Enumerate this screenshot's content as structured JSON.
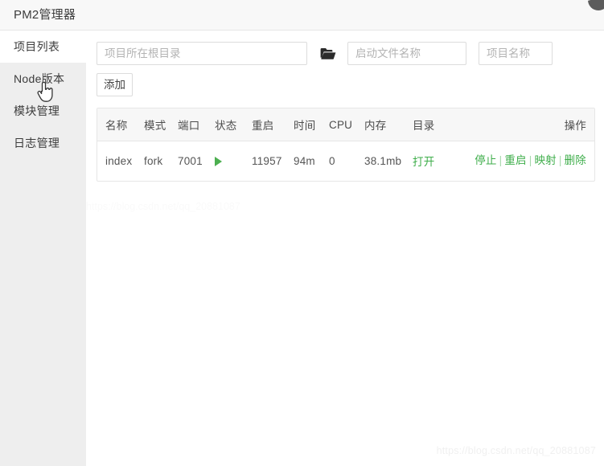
{
  "header": {
    "title": "PM2管理器",
    "corner_badge_name": "window-corner-badge"
  },
  "sidebar": {
    "items": [
      {
        "label": "项目列表",
        "name": "sidebar-item-project-list",
        "active": true
      },
      {
        "label": "Node版本",
        "name": "sidebar-item-node-version",
        "active": false
      },
      {
        "label": "模块管理",
        "name": "sidebar-item-module-manage",
        "active": false
      },
      {
        "label": "日志管理",
        "name": "sidebar-item-log-manage",
        "active": false
      }
    ]
  },
  "toolbar": {
    "root_dir_placeholder": "项目所在根目录",
    "root_dir_value": "",
    "folder_icon": "folder-open-icon",
    "start_file_placeholder": "启动文件名称",
    "start_file_value": "",
    "project_name_placeholder": "项目名称",
    "project_name_value": "",
    "add_label": "添加"
  },
  "table": {
    "columns": [
      "名称",
      "模式",
      "端口",
      "状态",
      "重启",
      "时间",
      "CPU",
      "内存",
      "目录",
      "操作"
    ],
    "rows": [
      {
        "name": "index",
        "mode": "fork",
        "port": "7001",
        "status_icon": "play-running-icon",
        "restart": "11957",
        "time": "94m",
        "cpu": "0",
        "memory": "38.1mb",
        "dir_label": "打开",
        "ops": [
          "停止",
          "重启",
          "映射",
          "删除"
        ],
        "ops_separator": "|"
      }
    ]
  },
  "watermark": {
    "text": "https://blog.csdn.net/qq_20881087"
  },
  "colors": {
    "accent_green": "#3fae4b",
    "play_green": "#4caf50",
    "sidebar_bg": "#eeeeee",
    "header_bg": "#f8f8f8",
    "table_head_bg": "#f7f7f7",
    "border": "#e6e6e6"
  }
}
